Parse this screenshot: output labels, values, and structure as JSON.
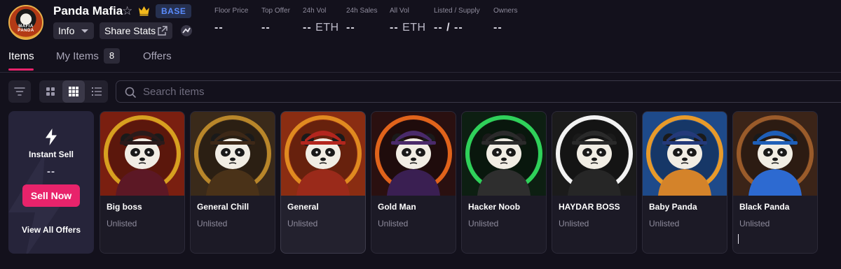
{
  "collection": {
    "title": "Panda Mafia",
    "logo_text": "MAFIA PANDA",
    "chain": "BASE",
    "accent": "#e8236b",
    "chain_color": "#5a8cff"
  },
  "actions": {
    "info_label": "Info",
    "share_label": "Share Stats"
  },
  "stats": [
    {
      "label": "Floor Price",
      "value": "--",
      "unit": ""
    },
    {
      "label": "Top Offer",
      "value": "--",
      "unit": ""
    },
    {
      "label": "24h Vol",
      "value": "--",
      "unit": "ETH"
    },
    {
      "label": "24h Sales",
      "value": "--",
      "unit": ""
    },
    {
      "label": "All Vol",
      "value": "--",
      "unit": "ETH"
    },
    {
      "label": "Listed / Supply",
      "value": "-- / --",
      "unit": ""
    },
    {
      "label": "Owners",
      "value": "--",
      "unit": ""
    }
  ],
  "tabs": [
    {
      "label": "Items",
      "active": true
    },
    {
      "label": "My Items",
      "count": "8"
    },
    {
      "label": "Offers"
    }
  ],
  "search": {
    "placeholder": "Search items"
  },
  "instant_sell": {
    "title": "Instant Sell",
    "value": "--",
    "button": "Sell Now",
    "link": "View All Offers"
  },
  "items": [
    {
      "name": "Big boss",
      "status": "Unlisted",
      "art_ring": "#d7a020",
      "art_bg": "#7a1f10",
      "hat": "#2b1a1a",
      "outfit": "#5c1825"
    },
    {
      "name": "General Chill",
      "status": "Unlisted",
      "art_ring": "#b8862a",
      "art_bg": "#3a2a1a",
      "hat": "#3d2817",
      "outfit": "#4a3218"
    },
    {
      "name": "General",
      "status": "Unlisted",
      "art_ring": "#e08a20",
      "art_bg": "#8a2d12",
      "hat": "#b3261e",
      "outfit": "#9a2a1a"
    },
    {
      "name": "Gold Man",
      "status": "Unlisted",
      "art_ring": "#e0631b",
      "art_bg": "#2a1010",
      "hat": "#4a2a6a",
      "outfit": "#3a1f52"
    },
    {
      "name": "Hacker Noob",
      "status": "Unlisted",
      "art_ring": "#2fd15a",
      "art_bg": "#0d1f12",
      "hat": "#2b2b2b",
      "outfit": "#2e2e2e"
    },
    {
      "name": "HAYDAR BOSS",
      "status": "Unlisted",
      "art_ring": "#f2f2f2",
      "art_bg": "#1b1b1b",
      "hat": "#2a2a2a",
      "outfit": "#262626"
    },
    {
      "name": "Baby Panda",
      "status": "Unlisted",
      "art_ring": "#e89a2a",
      "art_bg": "#1e4a8a",
      "hat": "#243a7a",
      "outfit": "#d4832a"
    },
    {
      "name": "Black Panda",
      "status": "Unlisted",
      "art_ring": "#9a5b2a",
      "art_bg": "#3b2418",
      "hat": "#1f5fb8",
      "outfit": "#2d6ad1"
    }
  ]
}
